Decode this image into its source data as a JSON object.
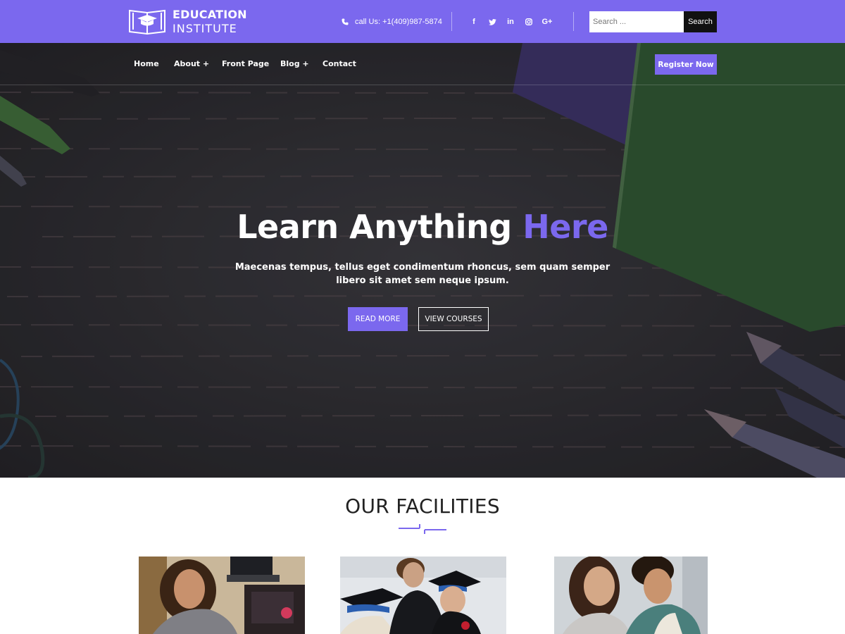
{
  "header": {
    "logo_line1": "EDUCATION",
    "logo_line2": "INSTITUTE",
    "phone_text": "call Us: +1(409)987-5874",
    "social_icons": [
      "facebook-icon",
      "twitter-icon",
      "linkedin-icon",
      "instagram-icon",
      "google-plus-icon"
    ],
    "search": {
      "placeholder": "Search ...",
      "button_label": "Search"
    }
  },
  "nav": {
    "items": [
      {
        "label": "Home"
      },
      {
        "label": "About +"
      },
      {
        "label": "Front Page"
      },
      {
        "label": "Blog +"
      },
      {
        "label": "Contact"
      }
    ],
    "register_label": "Register Now"
  },
  "hero": {
    "title_main": "Learn Anything",
    "title_accent": "Here",
    "subtitle": "Maecenas tempus, tellus eget condimentum rhoncus, sem quam semper libero sit amet sem neque ipsum.",
    "read_more_label": "READ MORE",
    "view_courses_label": "VIEW COURSES"
  },
  "facilities": {
    "title": "OUR FACILITIES",
    "cards": [
      {
        "image": "woman-at-desk-photo"
      },
      {
        "image": "graduation-photo"
      },
      {
        "image": "students-studying-photo"
      }
    ]
  },
  "colors": {
    "accent": "#7b68ee",
    "search_button": "#111111",
    "hero_background": "#2f2e33"
  }
}
